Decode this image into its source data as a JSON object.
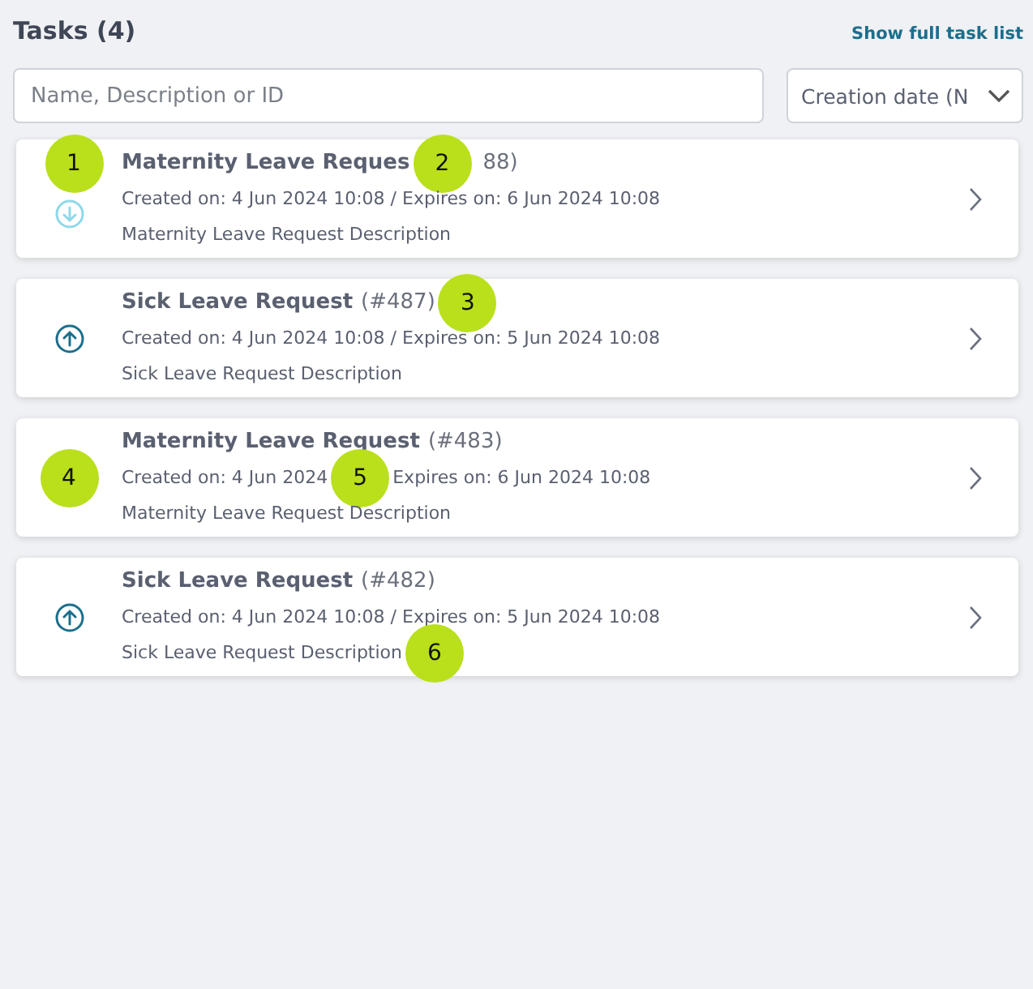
{
  "header": {
    "title": "Tasks (4)",
    "link": "Show full task list"
  },
  "search": {
    "placeholder": "Name, Description or ID"
  },
  "sort": {
    "value": "Creation date (N"
  },
  "tasks": [
    {
      "lead": [
        {
          "kind": "marker",
          "label": "1"
        },
        {
          "kind": "arrow-down"
        }
      ],
      "title": [
        {
          "kind": "name",
          "text": "Maternity Leave Reques"
        },
        {
          "kind": "marker",
          "label": "2"
        },
        {
          "kind": "id",
          "text": "88)"
        }
      ],
      "meta": [
        {
          "kind": "text",
          "text": "Created on: 4 Jun 2024 10:08 / Expires on: 6 Jun 2024 10:08"
        }
      ],
      "description": [
        {
          "kind": "text",
          "text": "Maternity Leave Request Description"
        }
      ]
    },
    {
      "lead": [
        {
          "kind": "arrow-up"
        }
      ],
      "title": [
        {
          "kind": "name",
          "text": "Sick Leave Request"
        },
        {
          "kind": "id",
          "text": "(#487)"
        },
        {
          "kind": "marker",
          "label": "3"
        }
      ],
      "meta": [
        {
          "kind": "text",
          "text": "Created on: 4 Jun 2024 10:08 / Expires on: 5 Jun 2024 10:08"
        }
      ],
      "description": [
        {
          "kind": "text",
          "text": "Sick Leave Request Description"
        }
      ]
    },
    {
      "lead": [
        {
          "kind": "marker",
          "label": "4"
        }
      ],
      "title": [
        {
          "kind": "name",
          "text": "Maternity Leave Request"
        },
        {
          "kind": "id",
          "text": "(#483)"
        }
      ],
      "meta": [
        {
          "kind": "text",
          "text": "Created on: 4 Jun 2024"
        },
        {
          "kind": "marker",
          "label": "5"
        },
        {
          "kind": "text",
          "text": "Expires on: 6 Jun 2024 10:08"
        }
      ],
      "description": [
        {
          "kind": "text",
          "text": "Maternity Leave Request Description"
        }
      ]
    },
    {
      "lead": [
        {
          "kind": "arrow-up"
        }
      ],
      "title": [
        {
          "kind": "name",
          "text": "Sick Leave Request"
        },
        {
          "kind": "id",
          "text": "(#482)"
        }
      ],
      "meta": [
        {
          "kind": "text",
          "text": "Created on: 4 Jun 2024 10:08 / Expires on: 5 Jun 2024 10:08"
        }
      ],
      "description": [
        {
          "kind": "text",
          "text": "Sick Leave Request Description"
        },
        {
          "kind": "marker",
          "label": "6"
        }
      ]
    }
  ]
}
